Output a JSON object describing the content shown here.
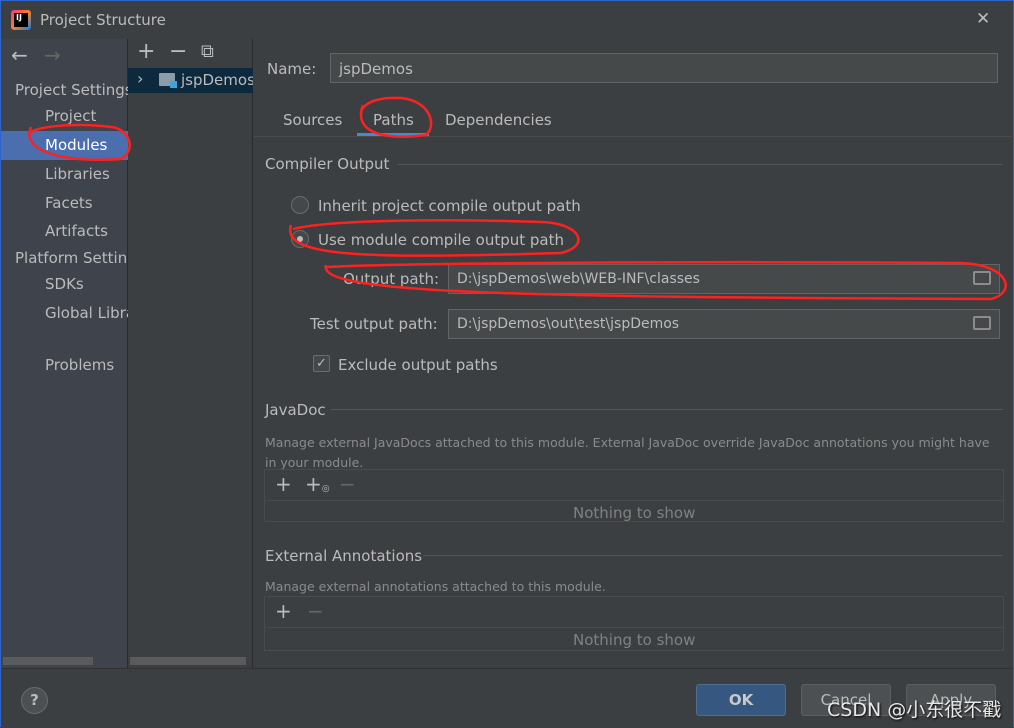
{
  "window": {
    "title": "Project Structure",
    "close": "✕"
  },
  "sidebar": {
    "back": "←",
    "forward": "→",
    "project_settings": "Project Settings",
    "items": [
      "Project",
      "Modules",
      "Libraries",
      "Facets",
      "Artifacts"
    ],
    "platform_settings": "Platform Settings",
    "platform_items": [
      "SDKs",
      "Global Libraries"
    ],
    "problems": "Problems",
    "selected": "Modules"
  },
  "middle": {
    "add": "+",
    "remove": "−",
    "copy": "⧉",
    "tree": [
      {
        "label": "jspDemos",
        "expand": "›"
      }
    ]
  },
  "main": {
    "name_label": "Name:",
    "name_value": "jspDemos",
    "tabs": [
      "Sources",
      "Paths",
      "Dependencies"
    ],
    "active_tab": "Paths",
    "compiler_output": {
      "title": "Compiler Output",
      "options": [
        "Inherit project compile output path",
        "Use module compile output path"
      ],
      "selected": 1,
      "output_label": "Output path:",
      "output_value": "D:\\jspDemos\\web\\WEB-INF\\classes",
      "test_label": "Test output path:",
      "test_value": "D:\\jspDemos\\out\\test\\jspDemos",
      "exclude_label": "Exclude output paths",
      "exclude_checked": true
    },
    "javadoc": {
      "title": "JavaDoc",
      "description": "Manage external JavaDocs attached to this module. External JavaDoc override JavaDoc annotations you might have in your module.",
      "empty": "Nothing to show"
    },
    "annotations": {
      "title": "External Annotations",
      "description": "Manage external annotations attached to this module.",
      "empty": "Nothing to show"
    }
  },
  "footer": {
    "help": "?",
    "ok": "OK",
    "cancel": "Cancel",
    "apply": "Apply"
  },
  "watermark": "CSDN @小东很不戳",
  "colors": {
    "selection": "#4b6eaf",
    "ok": "#365880",
    "annotation": "#ff2020"
  }
}
